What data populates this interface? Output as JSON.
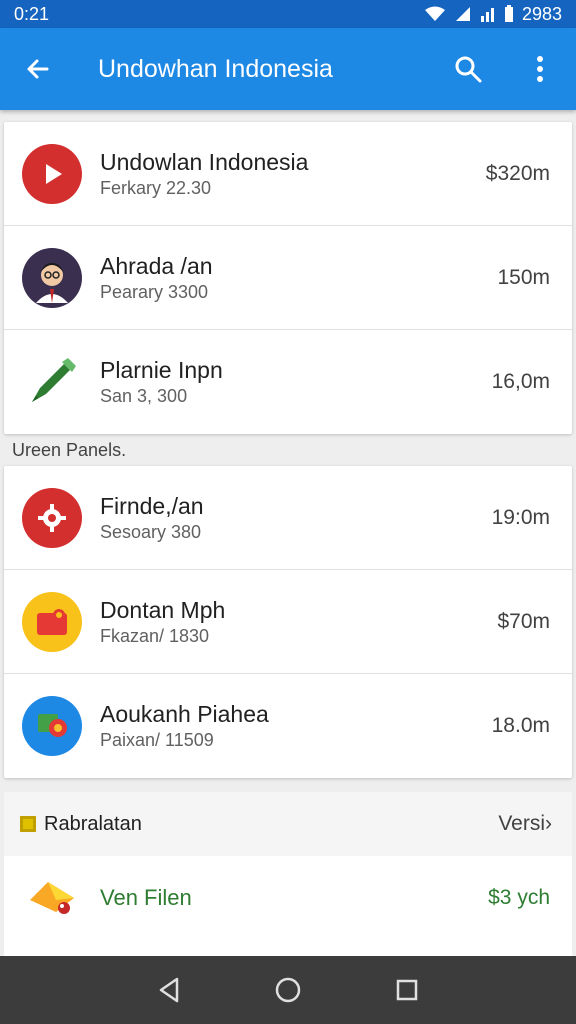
{
  "status": {
    "time": "0:21",
    "clock": "2983"
  },
  "app_bar": {
    "title": "Undowhan Indonesia",
    "back_icon": "arrow-left-icon",
    "search_icon": "search-icon",
    "menu_icon": "more-vert-icon"
  },
  "list1": [
    {
      "name": "Undowlan Indonesia",
      "sub": "Ferkary 22.30",
      "size": "$320m",
      "icon": "play-icon",
      "color": "#d32f2f"
    },
    {
      "name": "Ahrada /an",
      "sub": "Pearary 3300",
      "size": "150m",
      "icon": "avatar-icon",
      "color": "#3a2f4f"
    },
    {
      "name": "Plarnie Inpn",
      "sub": "San 3, 300",
      "size": "16,0m",
      "icon": "pen-icon",
      "color": "#2e7d32"
    }
  ],
  "section_label": "Ureen Panels.",
  "list2": [
    {
      "name": "Firnde,/an",
      "sub": "Sesoary 380",
      "size": "19:0m",
      "icon": "gear-icon",
      "color": "#d32f2f"
    },
    {
      "name": "Dontan Mph",
      "sub": "Fkazan/ 1830",
      "size": "$70m",
      "icon": "folder-icon",
      "color": "#f9c21a"
    },
    {
      "name": "Aoukanh Piahea",
      "sub": "Paixan/ 11509",
      "size": "18.0m",
      "icon": "app-icon",
      "color": "#1e88e5"
    }
  ],
  "bottom": {
    "header_left": "Rabralatan",
    "header_right": "Versi›",
    "item_name": "Ven Filen",
    "item_price": "$3 ych"
  },
  "nav": {
    "back": "nav-back-icon",
    "home": "nav-home-icon",
    "recents": "nav-recents-icon"
  }
}
